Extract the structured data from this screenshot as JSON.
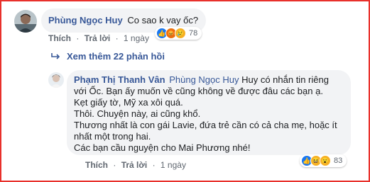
{
  "comment1": {
    "author": "Phùng Ngọc Huy",
    "text": "Co sao k vay ốc?",
    "actions": {
      "like": "Thích",
      "reply": "Trả lời",
      "time": "1 ngày"
    },
    "reaction_count": "78"
  },
  "more_replies": "Xem thêm 22 phản hồi",
  "comment2": {
    "author": "Phạm Thị Thanh Vân",
    "mention": "Phùng Ngọc Huy",
    "lines": [
      " Huy có nhắn tin riêng",
      "với Ốc. Bạn ấy muốn về cũng không về được đâu các bạn ạ.",
      "Kẹt giấy tờ, Mỹ xa xôi quá.",
      "Thôi. Chuyện này, ai cũng khổ.",
      "Thương nhất là con gái Lavie, đứa trẻ cần có cả cha mẹ, hoặc ít",
      "nhất một trong hai.",
      "Các bạn cầu nguyện cho Mai Phương nhé!"
    ],
    "actions": {
      "like": "Thích",
      "reply": "Trả lời",
      "time": "1 ngày"
    },
    "reaction_count": "83"
  },
  "colors": {
    "frame": "#e8302b",
    "link": "#385898",
    "bubble": "#f2f3f5"
  }
}
